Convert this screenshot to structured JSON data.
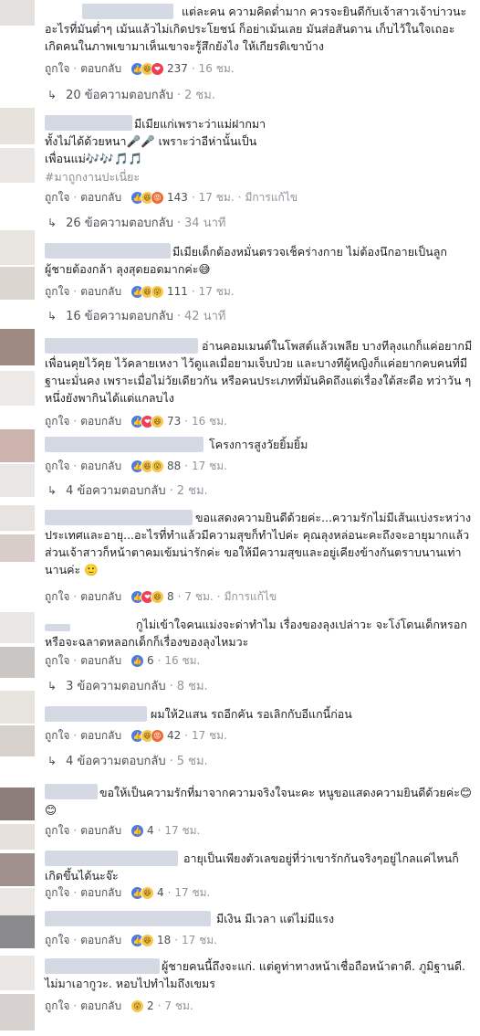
{
  "actions": {
    "like": "ถูกใจ",
    "reply": "ตอบกลับ",
    "edited": "มีการแก้ไข"
  },
  "comments": [
    {
      "text": "แต่ละคน ความคิดต่ำมาก ควรจะยินดีกับเจ้าสาวเจ้าบ่าวนะ อะไรที่มันต่ำๆ เม้นแล้วไม่เกิดประโยชน์ ก็อย่าเม้นเลย มันส่อสันดาน เก็บไว้ในใจเถอะ เกิดคนในภาพเขามาเห็นเขาจะรู้สึกยังไง ให้เกียรติเขาบ้าง",
      "reactions": [
        "like",
        "haha",
        "love"
      ],
      "count": "237",
      "time": "16 ชม.",
      "replies": "20 ข้อความตอบกลับ",
      "replies_time": "2 ชม."
    },
    {
      "text": "มีเมียแก่เพราะว่าแม่ฝากมา ทั้งไม่ได้ด้วยหนา🎤🎤 เพราะว่าอีห่านั้นเป็นเพื่อนแม่🎶🎶🎵🎵",
      "hashtag": "#มาถูกงานปะเนี่ยะ",
      "reactions": [
        "like",
        "haha",
        "angry"
      ],
      "count": "143",
      "time": "17 ชม.",
      "edited": true,
      "replies": "26 ข้อความตอบกลับ",
      "replies_time": "34 นาที"
    },
    {
      "text": "มีเมียเด็กต้องหมั่นตรวจเช็คร่างกาย ไม่ต้องนึกอายเป็นลูกผู้ชายต้องกล้า ลุงสุดยอดมากค่ะ😅",
      "reactions": [
        "like",
        "haha",
        "wow"
      ],
      "count": "111",
      "time": "17 ชม.",
      "replies": "16 ข้อความตอบกลับ",
      "replies_time": "42 นาที"
    },
    {
      "text": "อ่านคอมเมนต์ในโพสต์แล้วเพลีย บางทีลุงแกก็แค่อยากมีเพื่อนคุยไว้คุย ไว้คลายเหงา ไว้ดูแลเมื่อยามเจ็บป่วย และบางทีผู้หญิงก็แค่อยากคบคนที่มีฐานะมั่นคง เพราะเมื่อไม่วัยเดียวกัน หรือคนประเภทที่มันคิดถึงแต่เรื่องใต้สะดือ ทว่าวัน ๆ หนึ่งยังพากินได้แต่แกลบไง",
      "reactions": [
        "like",
        "love",
        "haha"
      ],
      "count": "73",
      "time": "16 ชม."
    },
    {
      "text": "โครงการสูงวัยยิ้มยิ้ม",
      "reactions": [
        "like",
        "haha",
        "wow"
      ],
      "count": "88",
      "time": "17 ชม.",
      "replies": "4 ข้อความตอบกลับ",
      "replies_time": "2 ชม."
    },
    {
      "text": "ขอแสดงความยินดีด้วยค่ะ...ความรักไม่มีเส้นแบ่งระหว่างประเทศและอายุ...อะไรที่ทำแล้วมีความสุขก็ทำไปค่ะ คุณลุงหล่อนะคะถึงจะอายุมากแล้ว ส่วนเจ้าสาวก็หน้าตาคมเข้มน่ารักค่ะ ขอให้มีความสุขและอยู่เคียงข้างกันตราบนานเท่านานค่ะ 🙂",
      "reactions": [
        "like",
        "love",
        "haha"
      ],
      "count": "8",
      "time": "7 ชม.",
      "edited": true
    },
    {
      "text": "กูไม่เข้าใจคนแม่งจะด่าทำไม เรื่องของลุงเปล่าวะ จะโง่โดนเด็กหรอก หรือจะฉลาดหลอกเด็กก็เรื่องของลุงไหมวะ",
      "reactions": [
        "like"
      ],
      "count": "6",
      "time": "16 ชม.",
      "replies": "3 ข้อความตอบกลับ",
      "replies_time": "8 ชม."
    },
    {
      "text": "ผมให้2แสน รถอีกคัน รอเลิกกับอีแกนี้ก่อน",
      "reactions": [
        "like",
        "haha",
        "angry"
      ],
      "count": "42",
      "time": "17 ชม.",
      "replies": "4 ข้อความตอบกลับ",
      "replies_time": "5 ชม."
    },
    {
      "text": "ขอให้เป็นความรักที่มาจากความจริงใจนะคะ หนูขอแสดงความยินดีด้วยค่ะ😊😊",
      "reactions": [
        "like"
      ],
      "count": "4",
      "time": "17 ชม."
    },
    {
      "text": "อายุเป็นเพียงตัวเลขอยู่ที่ว่าเขารักกันจริงๆอยู่ไกลแค่ไหนก็เกิดขึ้นได้นะจ๊ะ",
      "reactions": [
        "like",
        "haha"
      ],
      "count": "4",
      "time": "17 ชม."
    },
    {
      "text": "มีเงิน มีเวลา แต่ไม่มีแรง",
      "reactions": [
        "like",
        "haha"
      ],
      "count": "18",
      "time": "17 ชม."
    },
    {
      "text": "ผู้ชายคนนี้ถึงจะแก่. แต่ดูท่าทางหน้าเชื่อถือหน้าตาดี. ภูมิฐานดี. ไม่มาเอากูวะ. หอบไปทำไมถึงเขมร",
      "reactions": [
        "wow"
      ],
      "count": "2",
      "time": "7 ชม."
    }
  ]
}
